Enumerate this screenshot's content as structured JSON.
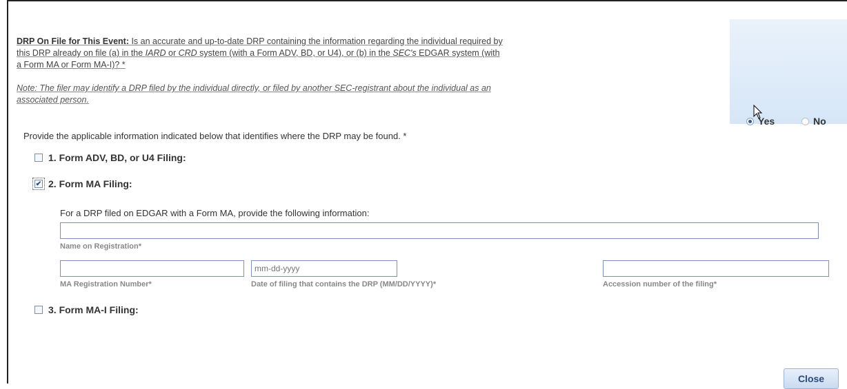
{
  "question": {
    "title": "DRP On File for This Event:",
    "text_part1": " Is an accurate and up-to-date DRP containing the information regarding the individual required by",
    "line2_a": "this DRP already on file (a) in the ",
    "line2_iard": "IARD",
    "line2_b": " or ",
    "line2_crd": "CRD",
    "line2_c": " system (with a Form ADV, BD, or U4), or (b) in the ",
    "line2_sec": "SEC's",
    "line2_d": " EDGAR system (with",
    "line3": "a Form MA or Form MA-I)? *",
    "note_line1": "Note: The filer may identify a DRP filed by the individual directly, or filed by another SEC-registrant about the individual as an",
    "note_line2": "associated person."
  },
  "answer": {
    "yes_label": "Yes",
    "no_label": "No",
    "selected": "Yes"
  },
  "instructions": "Provide the applicable information indicated below that identifies where the DRP may be found. *",
  "options": [
    {
      "label": "1. Form ADV, BD, or U4 Filing:",
      "checked": false
    },
    {
      "label": "2. Form MA Filing:",
      "checked": true
    },
    {
      "label": "3. Form MA-I Filing:",
      "checked": false
    }
  ],
  "form_ma": {
    "instructions": "For a DRP filed on EDGAR with a Form MA, provide the following information:",
    "name_label": "Name on Registration",
    "reg_number_label": "MA Registration Number",
    "date_label": "Date of filing that contains the DRP (MM/DD/YYYY)",
    "date_placeholder": "mm-dd-yyyy",
    "accession_label": "Accession number of the filing",
    "required_mark": "*"
  },
  "close_label": "Close",
  "colors": {
    "panel_bg": "#d6e6f7",
    "field_border": "#7a8fb8",
    "button_text": "#2a4a7a"
  }
}
